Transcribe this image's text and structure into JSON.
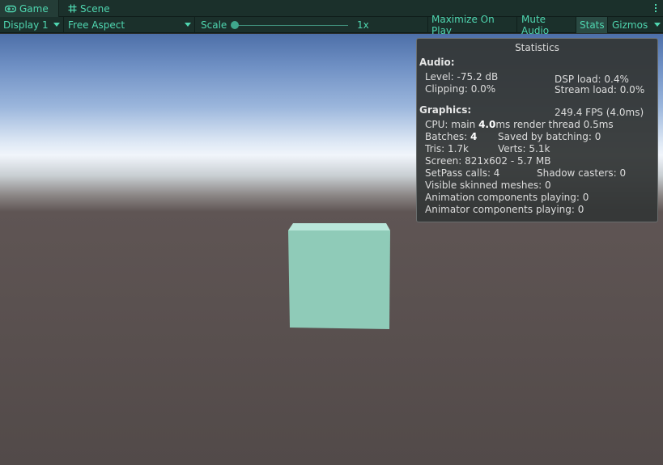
{
  "tabs": [
    {
      "label": "Game",
      "icon": "gamepad-icon",
      "active": true
    },
    {
      "label": "Scene",
      "icon": "grid-hash-icon",
      "active": false
    }
  ],
  "toolbar": {
    "display": "Display 1",
    "aspect": "Free Aspect",
    "scale_label": "Scale",
    "scale_value": "1x",
    "maximize_on_play": "Maximize On Play",
    "mute_audio": "Mute Audio",
    "stats": "Stats",
    "gizmos": "Gizmos"
  },
  "colors": {
    "accent": "#4fd6b0",
    "toolbar_bg": "#1b302b",
    "cube": "#8fcbb8"
  },
  "stats": {
    "title": "Statistics",
    "audio_header": "Audio:",
    "level": "Level: -75.2 dB",
    "clipping": "Clipping: 0.0%",
    "dsp_load": "DSP load: 0.4%",
    "stream_load": "Stream load: 0.0%",
    "graphics_header": "Graphics:",
    "fps": "249.4 FPS (4.0ms)",
    "cpu_prefix": "CPU: main ",
    "cpu_main": "4.0",
    "cpu_suffix": "ms  render thread 0.5ms",
    "batches_prefix": "Batches: ",
    "batches": "4",
    "saved_by_batching": "Saved by batching: 0",
    "tris": "Tris: 1.7k",
    "verts": "Verts: 5.1k",
    "screen": "Screen: 821x602 - 5.7 MB",
    "setpass": "SetPass calls: 4",
    "shadow_casters": "Shadow casters: 0",
    "skinned_meshes": "Visible skinned meshes: 0",
    "animation_components": "Animation components playing: 0",
    "animator_components": "Animator components playing: 0"
  }
}
